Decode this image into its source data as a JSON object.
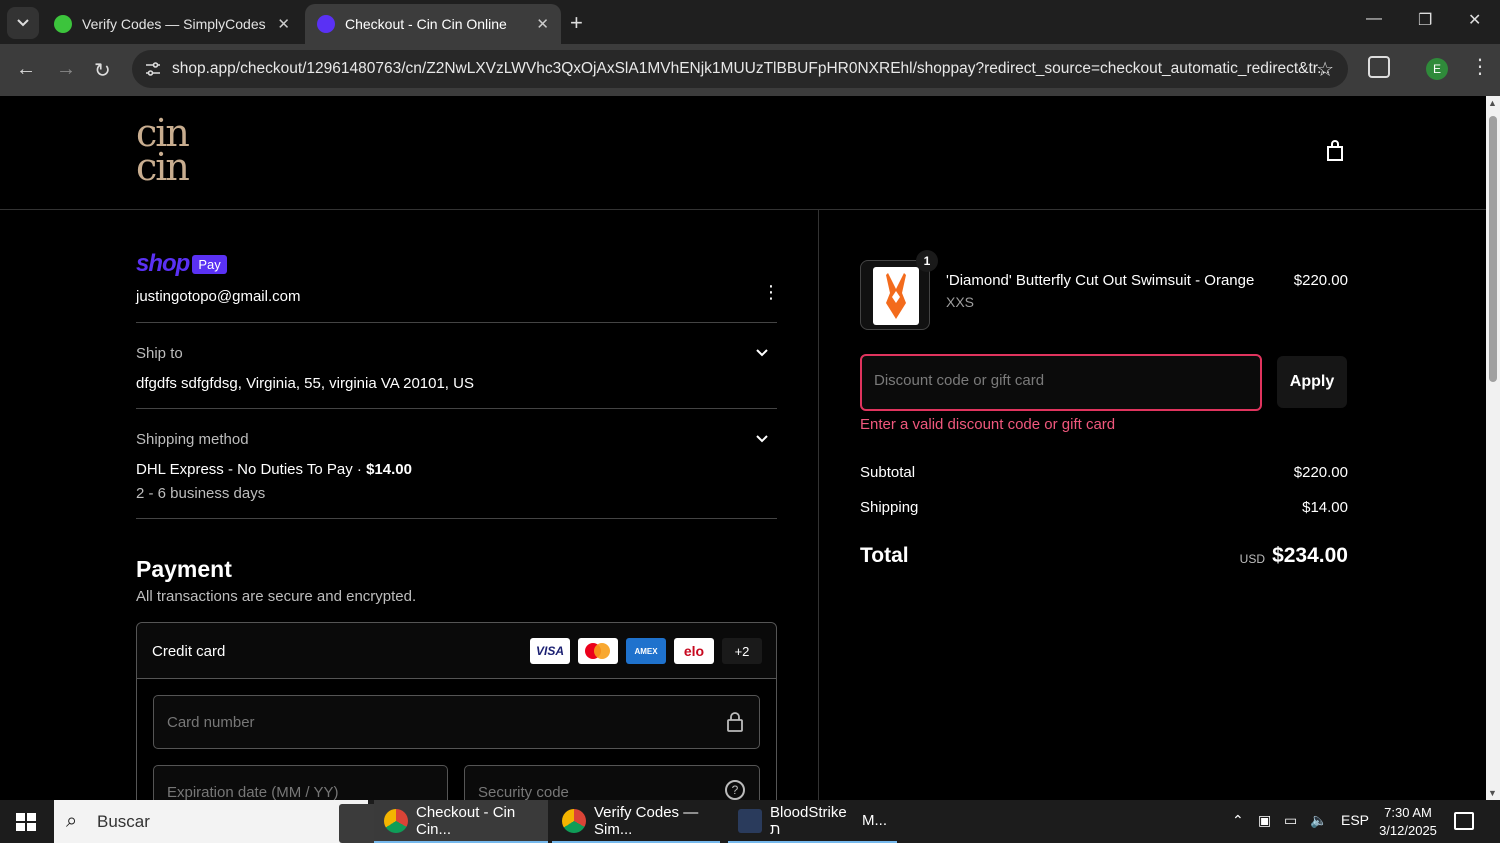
{
  "browser": {
    "tabs": [
      {
        "title": "Verify Codes — SimplyCodes",
        "active": false
      },
      {
        "title": "Checkout - Cin Cin Online",
        "active": true
      }
    ],
    "url": "shop.app/checkout/12961480763/cn/Z2NwLXVzLWVhc3QxOjAxSlA1MVhENjk1MUUzTlBBUFpHR0NXREhl/shoppay?redirect_source=checkout_automatic_redirect&tr...",
    "profile_initial": "E"
  },
  "store": {
    "logo_text": "cin\ncin"
  },
  "shoppay": {
    "shop_word": "shop",
    "pay_word": "Pay",
    "email": "justingotopo@gmail.com"
  },
  "ship_to": {
    "label": "Ship to",
    "address": "dfgdfs sdfgfdsg, Virginia, 55, virginia VA 20101, US"
  },
  "shipping_method": {
    "label": "Shipping method",
    "method": "DHL Express - No Duties To Pay · ",
    "price": "$14.00",
    "eta": "2 - 6 business days"
  },
  "payment": {
    "title": "Payment",
    "subtitle": "All transactions are secure and encrypted.",
    "method_label": "Credit card",
    "cards": [
      "VISA",
      "mastercard",
      "AMEX",
      "elo"
    ],
    "more_cards": "+2",
    "card_number_placeholder": "Card number",
    "expiry_placeholder": "Expiration date (MM / YY)",
    "security_placeholder": "Security code"
  },
  "order": {
    "item": {
      "quantity": "1",
      "name": "'Diamond' Butterfly Cut Out Swimsuit - Orange",
      "variant": "XXS",
      "price": "$220.00"
    },
    "discount": {
      "placeholder": "Discount code or gift card",
      "value": "",
      "apply_label": "Apply",
      "error": "Enter a valid discount code or gift card"
    },
    "subtotal_label": "Subtotal",
    "subtotal": "$220.00",
    "shipping_label": "Shipping",
    "shipping": "$14.00",
    "total_label": "Total",
    "currency": "USD",
    "total": "$234.00"
  },
  "taskbar": {
    "search_label": "Buscar",
    "tasks": [
      {
        "label": "Checkout - Cin Cin..."
      },
      {
        "label": "Verify Codes — Sim..."
      },
      {
        "label": "BloodStrike ת"
      },
      {
        "label": "M..."
      }
    ],
    "language": "ESP",
    "time": "7:30 AM",
    "date": "3/12/2025"
  },
  "colors": {
    "shop_purple": "#5a31f4",
    "error_pink": "#e0345e",
    "logo_tan": "#c8ad8f"
  }
}
